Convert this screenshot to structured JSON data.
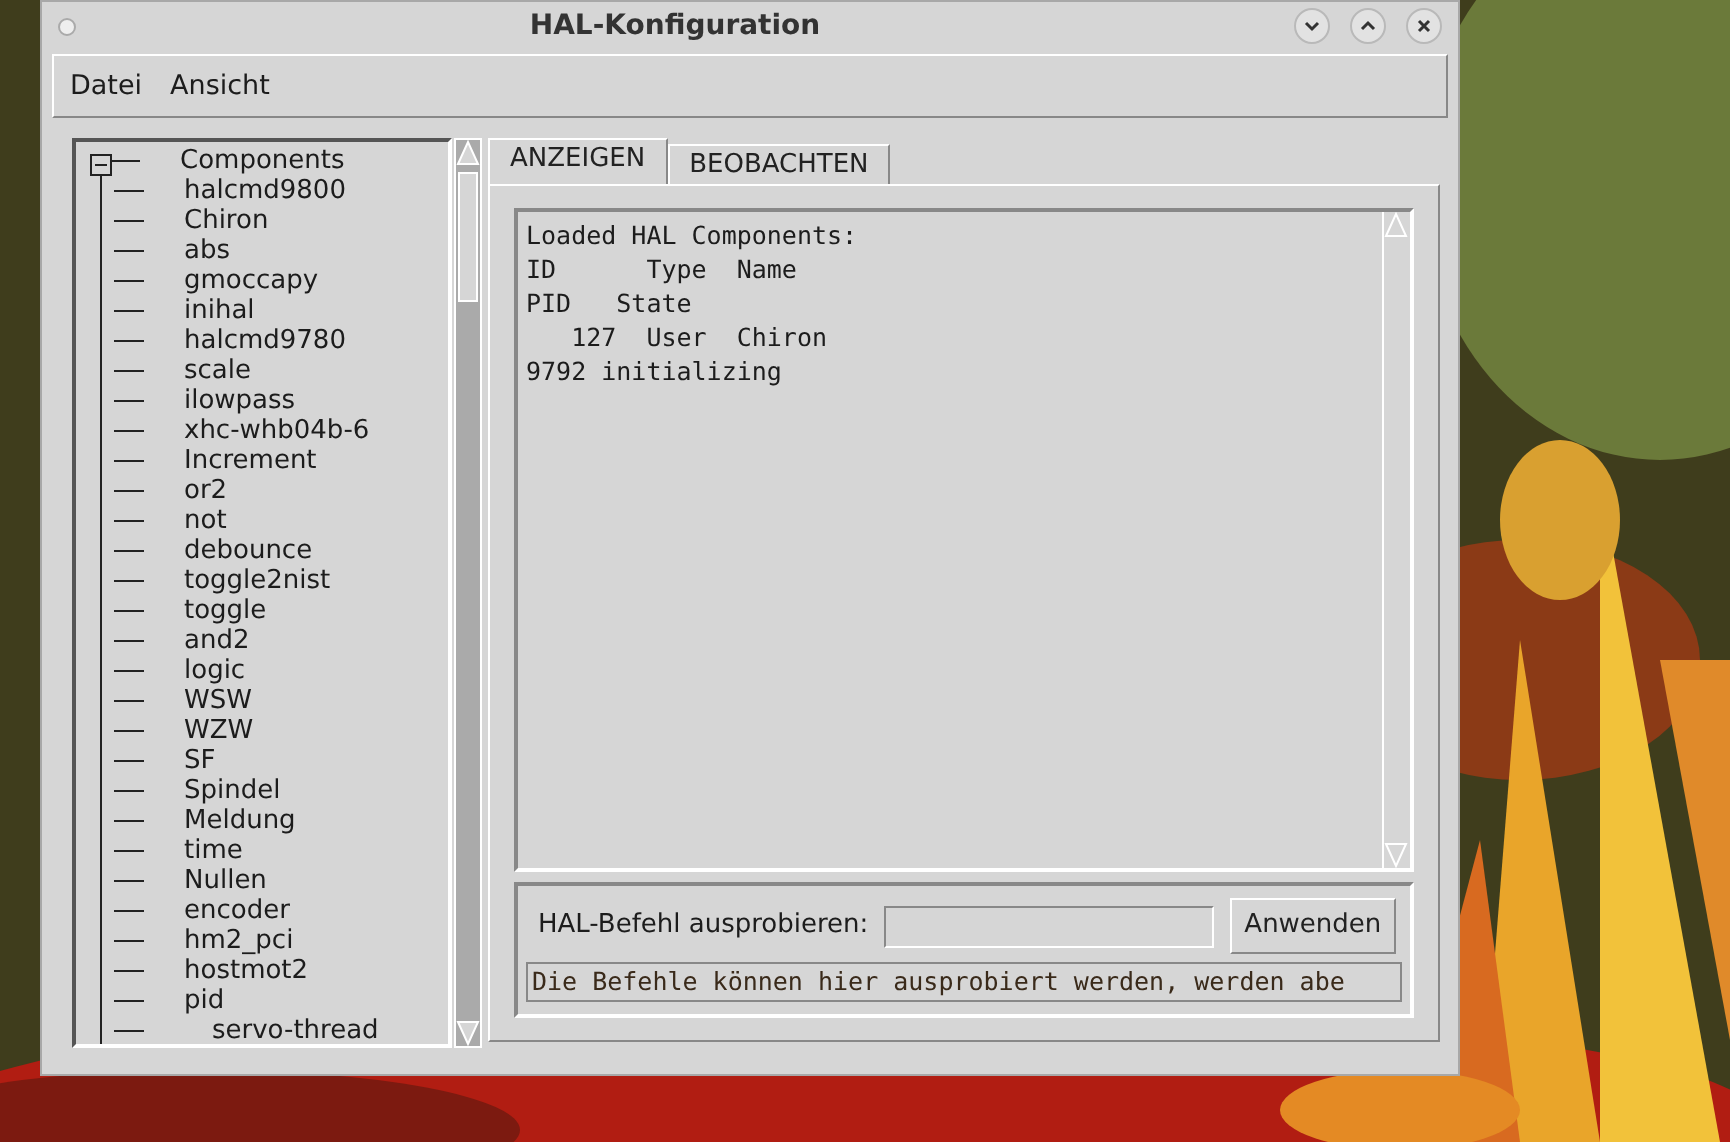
{
  "window": {
    "title": "HAL-Konfiguration"
  },
  "menu": [
    "Datei",
    "Ansicht"
  ],
  "tree": {
    "label": "Components",
    "expanded": true,
    "children": [
      {
        "label": "halcmd9800"
      },
      {
        "label": "Chiron"
      },
      {
        "label": "abs"
      },
      {
        "label": "gmoccapy"
      },
      {
        "label": "inihal"
      },
      {
        "label": "halcmd9780"
      },
      {
        "label": "scale"
      },
      {
        "label": "ilowpass"
      },
      {
        "label": "xhc-whb04b-6"
      },
      {
        "label": "Increment"
      },
      {
        "label": "or2"
      },
      {
        "label": "not"
      },
      {
        "label": "debounce"
      },
      {
        "label": "toggle2nist"
      },
      {
        "label": "toggle"
      },
      {
        "label": "and2"
      },
      {
        "label": "logic"
      },
      {
        "label": "WSW"
      },
      {
        "label": "WZW"
      },
      {
        "label": "SF"
      },
      {
        "label": "Spindel"
      },
      {
        "label": "Meldung"
      },
      {
        "label": "time"
      },
      {
        "label": "Nullen"
      },
      {
        "label": "encoder"
      },
      {
        "label": "hm2_pci"
      },
      {
        "label": "hostmot2"
      },
      {
        "label": "pid",
        "children": [
          {
            "label": "servo-thread"
          }
        ]
      }
    ]
  },
  "tabs": [
    {
      "label": "ANZEIGEN",
      "selected": true
    },
    {
      "label": "BEOBACHTEN",
      "selected": false
    }
  ],
  "output_lines": [
    "Loaded HAL Components:",
    "ID      Type  Name",
    "PID   State",
    "   127  User  Chiron",
    "9792 initializing"
  ],
  "command": {
    "label": "HAL-Befehl ausprobieren:",
    "button": "Anwenden",
    "hint": "Die Befehle können hier ausprobiert werden, werden abe"
  }
}
